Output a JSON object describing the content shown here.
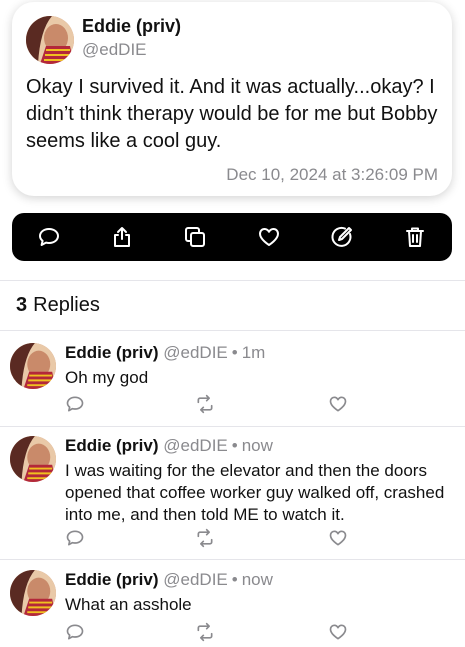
{
  "post": {
    "author": "Eddie (priv)",
    "handle": "@edDIE",
    "text": "Okay I survived it. And it was actually...okay? I didn’t think therapy would be for me but Bobby seems like a cool guy.",
    "timestamp": "Dec 10, 2024 at 3:26:09 PM"
  },
  "actions": [
    "reply-icon",
    "share-icon",
    "copy-icon",
    "like-icon",
    "edit-icon",
    "delete-icon"
  ],
  "replies_header": {
    "count": "3",
    "label": "Replies"
  },
  "replies": [
    {
      "author": "Eddie (priv)",
      "handle": "@edDIE",
      "time": "1m",
      "text": "Oh my god"
    },
    {
      "author": "Eddie (priv)",
      "handle": "@edDIE",
      "time": "now",
      "text": "I was waiting for the elevator and then the doors opened that coffee worker guy walked off, crashed into me, and then told ME to watch it."
    },
    {
      "author": "Eddie (priv)",
      "handle": "@edDIE",
      "time": "now",
      "text": "What an asshole"
    }
  ],
  "colors": {
    "secondary_text": "#8a8a8e",
    "action_bar": "#000000"
  }
}
